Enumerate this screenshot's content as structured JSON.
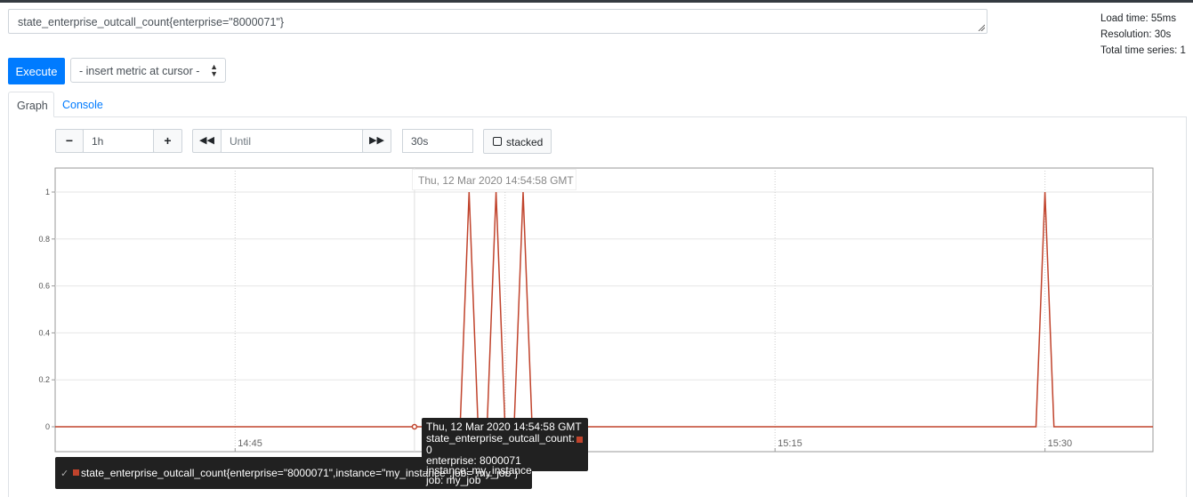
{
  "query": {
    "expression": "state_enterprise_outcall_count{enterprise=\"8000071\"}"
  },
  "stats": {
    "load_time": "Load time: 55ms",
    "resolution": "Resolution: 30s",
    "total_series": "Total time series: 1"
  },
  "toolbar": {
    "execute_label": "Execute",
    "metric_select_label": "- insert metric at cursor -"
  },
  "tabs": [
    {
      "label": "Graph",
      "active": true
    },
    {
      "label": "Console",
      "active": false
    }
  ],
  "controls": {
    "range_value": "1h",
    "until_placeholder": "Until",
    "resolution_value": "30s",
    "stacked_label": "stacked"
  },
  "hover": {
    "timestamp": "Thu, 12 Mar 2020 14:54:58 GMT"
  },
  "tooltip": {
    "time": "Thu, 12 Mar 2020 14:54:58 GMT",
    "metric": "state_enterprise_outcall_count:",
    "value": "0",
    "enterprise": "enterprise: 8000071",
    "instance": "instance: my_instance",
    "job": "job: my_job"
  },
  "legend": {
    "label": "state_enterprise_outcall_count{enterprise=\"8000071\",instance=\"my_instance\",job=\"my_job\"}"
  },
  "colors": {
    "series": "#c0432c",
    "accent": "#007bff"
  },
  "chart_data": {
    "type": "line",
    "x_tick_labels": [
      "14:45",
      "15:15",
      "15:30"
    ],
    "y_tick_labels": [
      "0",
      "0.2",
      "0.4",
      "0.6",
      "0.8",
      "1"
    ],
    "ylim": [
      0,
      1
    ],
    "grid": true,
    "series": [
      {
        "x": [
          "14:35",
          "14:57:30",
          "14:58",
          "14:58:30",
          "14:59",
          "14:59:30",
          "15:00",
          "15:00:30",
          "15:01",
          "15:01:30",
          "15:02",
          "15:29:30",
          "15:30",
          "15:30:30",
          "15:36"
        ],
        "values": [
          0,
          0,
          1,
          0,
          0,
          1,
          0,
          0,
          1,
          0,
          0,
          0,
          1,
          0,
          0
        ]
      }
    ]
  }
}
